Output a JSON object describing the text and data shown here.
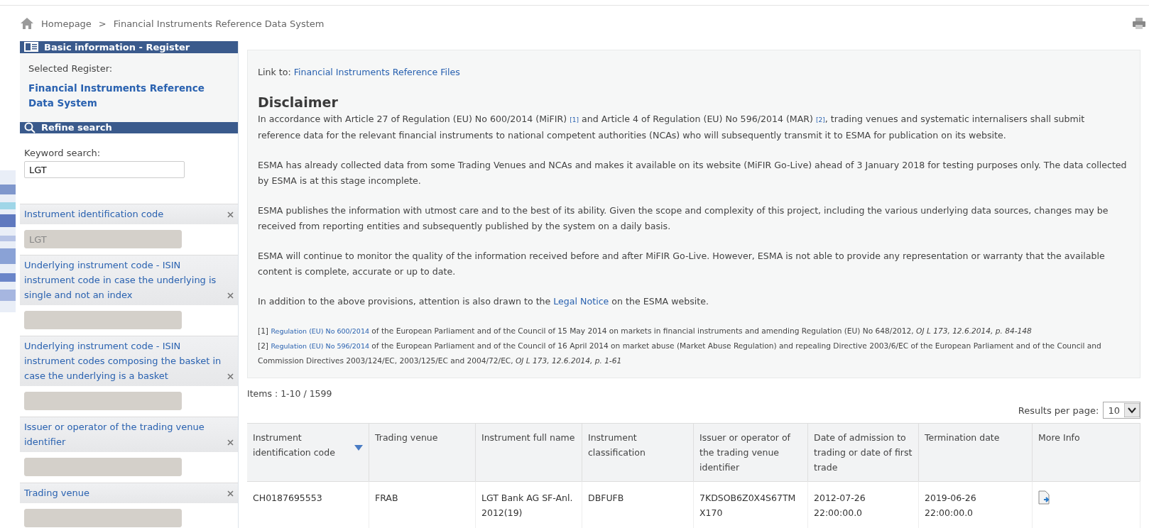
{
  "breadcrumb": [
    "Homepage",
    ">",
    "Financial Instruments Reference Data System"
  ],
  "sidebar": {
    "register_panel": {
      "title": "Basic information - Register",
      "label": "Selected Register:",
      "value": "Financial Instruments Reference Data System"
    },
    "search_panel": {
      "title": "Refine search",
      "keyword_label": "Keyword search:",
      "keyword_value": "LGT",
      "filters": [
        {
          "label": "Instrument identification code",
          "value": "LGT",
          "disabled": true
        },
        {
          "label": "Underlying instrument code - ISIN instrument code in case the underlying is single and not an index",
          "disabled": true
        },
        {
          "label": "Underlying instrument code - ISIN instrument codes composing the basket in case the underlying is a basket",
          "disabled": true
        },
        {
          "label": "Issuer or operator of the trading venue identifier",
          "disabled": true
        },
        {
          "label": "Trading venue",
          "disabled": true
        }
      ]
    }
  },
  "disclaimer": {
    "link_label": "Link to:",
    "link": "Financial Instruments Reference Files",
    "title": "Disclaimer",
    "paragraphs": [
      [
        {
          "kind": "text",
          "text": "In accordance with Article 27 of Regulation (EU) No 600/2014 (MiFIR) "
        },
        {
          "kind": "ref",
          "text": "[1]"
        },
        {
          "kind": "text",
          "text": " and Article 4 of Regulation (EU) No 596/2014 (MAR) "
        },
        {
          "kind": "ref",
          "text": "[2]"
        },
        {
          "kind": "text",
          "text": ", trading venues and systematic internalisers shall submit reference data for the relevant financial instruments to national competent authorities (NCAs) who will subsequently transmit it to ESMA for publication on its website."
        }
      ],
      [
        {
          "kind": "text",
          "text": "ESMA has already collected data from some Trading Venues and NCAs and makes it available on its website (MiFIR Go-Live) ahead of 3 January 2018 for testing purposes only. The data collected by ESMA is at this stage incomplete."
        }
      ],
      [
        {
          "kind": "text",
          "text": "ESMA publishes the information with utmost care and to the best of its ability. Given the scope and complexity of this project, including the various underlying data sources, changes may be received from reporting entities and subsequently published by the system on a daily basis."
        }
      ],
      [
        {
          "kind": "text",
          "text": "ESMA will continue to monitor the quality of the information received before and after MiFIR Go-Live. However, ESMA is not able to provide any representation or warranty that the available content is complete, accurate or up to date."
        }
      ],
      [
        {
          "kind": "text",
          "text": "In addition to the above provisions, attention is also drawn to the "
        },
        {
          "kind": "link",
          "text": "Legal Notice"
        },
        {
          "kind": "text",
          "text": " on the ESMA website."
        }
      ]
    ],
    "footnotes": [
      {
        "mark": "[1]",
        "link": "Regulation (EU) No 600/2014",
        "text": " of the European Parliament and of the Council of 15 May 2014 on markets in financial instruments and amending Regulation (EU) No 648/2012, *OJ L 173, 12.6.2014, p. 84-148*"
      },
      {
        "mark": "[2]",
        "link": "Regulation (EU) No 596/2014",
        "text": " of the European Parliament and of the Council of 16 April 2014 on market abuse (Market Abuse Regulation) and repealing Directive 2003/6/EC of the European Parliament and of the Council and Commission Directives 2003/124/EC, 2003/125/EC and 2004/72/EC, *OJ L 173, 12.6.2014, p. 1-61*"
      }
    ]
  },
  "items_count": "Items : 1-10 / 1599",
  "results_per_page": {
    "label": "Results per page:",
    "value": "10"
  },
  "table": {
    "columns": [
      {
        "label": "Instrument identification code",
        "sorted": true
      },
      {
        "label": "Trading venue",
        "sorted": false
      },
      {
        "label": "Instrument full name",
        "sorted": false
      },
      {
        "label": "Instrument classification",
        "sorted": false
      },
      {
        "label": "Issuer or operator of the trading venue identifier",
        "sorted": false
      },
      {
        "label": "Date of admission to trading or date of first trade",
        "sorted": false
      },
      {
        "label": "Termination date",
        "sorted": false
      },
      {
        "label": "More Info",
        "sorted": false
      }
    ],
    "rows": [
      {
        "cells": [
          "CH0187695553",
          "FRAB",
          "LGT Bank AG SF-Anl. 2012(19)",
          "DBFUFB",
          "7KDSOB6Z0X4S67TM X170",
          "2012-07-26 22:00:00.0",
          "2019-06-26 22:00:00.0"
        ],
        "more_info": true
      }
    ]
  }
}
